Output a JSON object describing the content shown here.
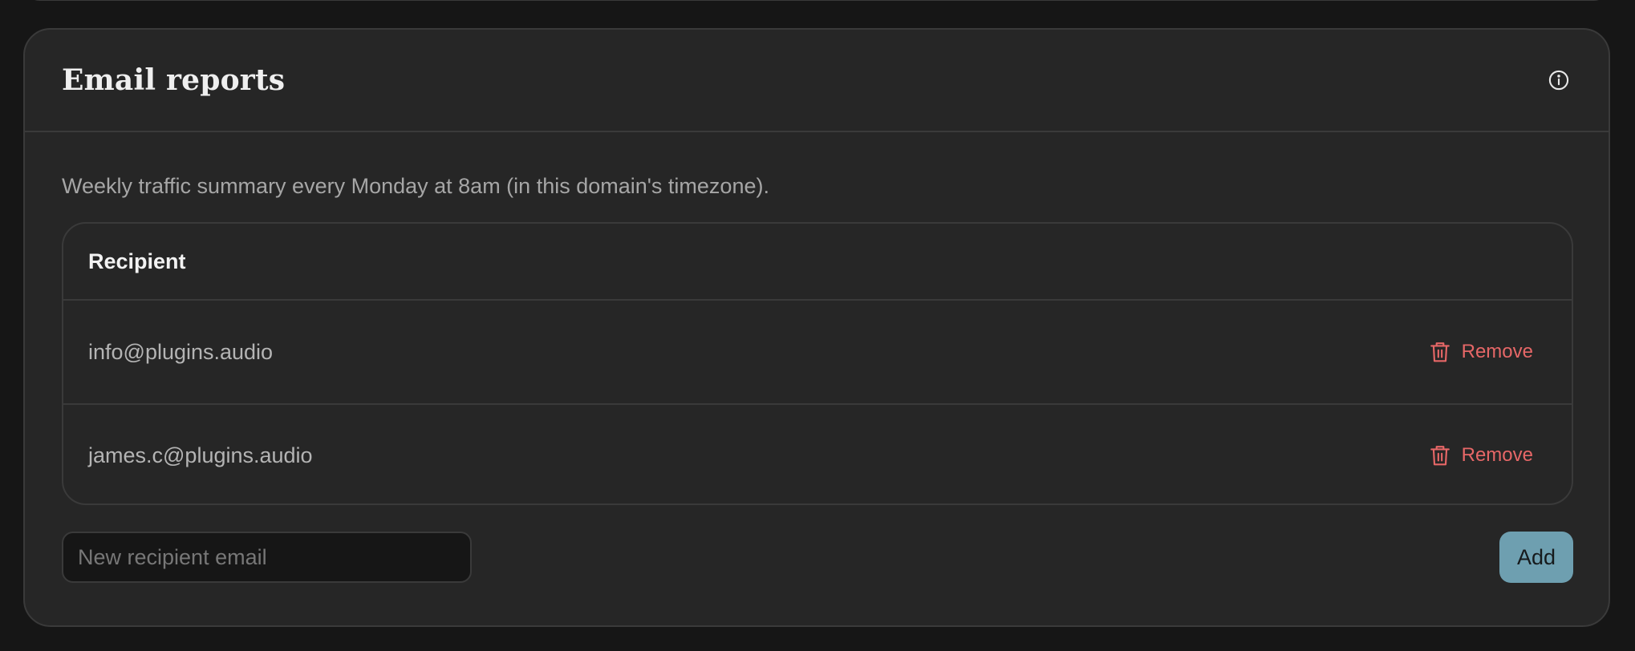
{
  "card": {
    "title": "Email reports",
    "description": "Weekly traffic summary every Monday at 8am (in this domain's timezone)."
  },
  "table": {
    "header": "Recipient",
    "rows": [
      {
        "email": "info@plugins.audio",
        "action_label": "Remove"
      },
      {
        "email": "james.c@plugins.audio",
        "action_label": "Remove"
      }
    ]
  },
  "add_form": {
    "placeholder": "New recipient email",
    "value": "",
    "button_label": "Add"
  },
  "icons": {
    "header": "info-icon",
    "row_action": "trash-icon"
  },
  "colors": {
    "danger": "#e66767",
    "accent": "#6e9fb0"
  }
}
